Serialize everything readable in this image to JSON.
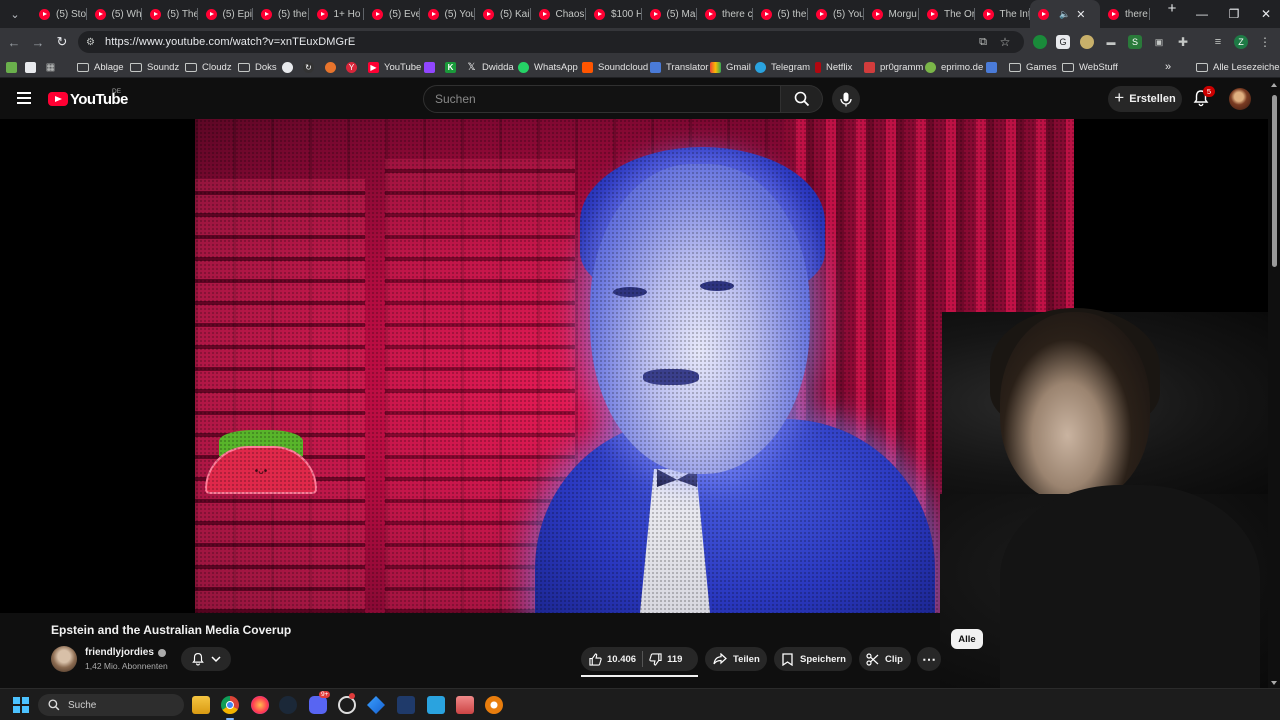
{
  "browser": {
    "tabs": [
      {
        "label": "(5) Sto"
      },
      {
        "label": "(5) Wh"
      },
      {
        "label": "(5) The"
      },
      {
        "label": "(5) Epi"
      },
      {
        "label": "(5) the"
      },
      {
        "label": "1+ Ho"
      },
      {
        "label": "(5) Eve"
      },
      {
        "label": "(5) You"
      },
      {
        "label": "(5) Kai"
      },
      {
        "label": "Chaos"
      },
      {
        "label": "$100 H"
      },
      {
        "label": "(5) Ma"
      },
      {
        "label": "there c"
      },
      {
        "label": "(5) the"
      },
      {
        "label": "(5) You"
      },
      {
        "label": "Morgu"
      },
      {
        "label": "The Or"
      },
      {
        "label": "The Int"
      }
    ],
    "active_tab_label": "",
    "last_tab_label": "there c",
    "url": "https://www.youtube.com/watch?v=xnTEuxDMGrE",
    "bookmarks": [
      {
        "label": "Ablage",
        "type": "folder"
      },
      {
        "label": "Soundz",
        "type": "folder"
      },
      {
        "label": "Cloudz",
        "type": "folder"
      },
      {
        "label": "Doks",
        "type": "folder"
      },
      {
        "label": "YouTube",
        "type": "link"
      },
      {
        "label": "Dwidda",
        "type": "link"
      },
      {
        "label": "WhatsApp",
        "type": "link"
      },
      {
        "label": "Soundcloud",
        "type": "link"
      },
      {
        "label": "Translator",
        "type": "link"
      },
      {
        "label": "Gmail",
        "type": "link"
      },
      {
        "label": "Telegram",
        "type": "link"
      },
      {
        "label": "Netflix",
        "type": "link"
      },
      {
        "label": "pr0gramm",
        "type": "link"
      },
      {
        "label": "eprimo.de",
        "type": "link"
      },
      {
        "label": "Games",
        "type": "folder"
      },
      {
        "label": "WebStuff",
        "type": "folder"
      }
    ],
    "bookmarks_overflow": "»",
    "all_bookmarks": "Alle Lesezeichen",
    "profile_initial": "Z"
  },
  "youtube": {
    "logo_text": "YouTube",
    "country": "DE",
    "search_placeholder": "Suchen",
    "create_label": "Erstellen",
    "notification_count": "5",
    "video": {
      "title": "Epstein and the Australian Media Coverup",
      "channel": "friendlyjordies",
      "subscribers": "1,42 Mio. Abonnenten",
      "likes": "10.406",
      "dislikes": "119",
      "share_label": "Teilen",
      "save_label": "Speichern",
      "clip_label": "Clip"
    },
    "filter_chip": "Alle"
  },
  "taskbar": {
    "search_label": "Suche",
    "discord_badge": "9+"
  },
  "colors": {
    "youtube_red": "#ff0033",
    "background": "#0f0f0f",
    "chrome_dark": "#202124",
    "chrome_toolbar": "#35363a"
  }
}
